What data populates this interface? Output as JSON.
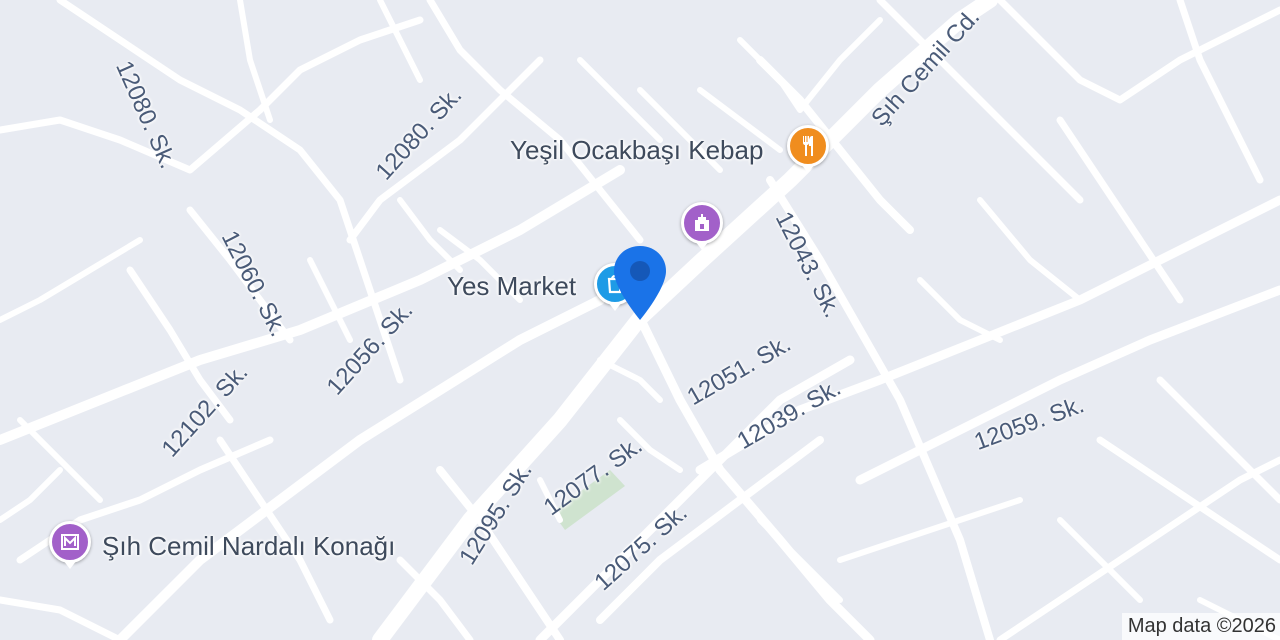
{
  "map": {
    "background_color": "#e8ebf2",
    "road_color": "#ffffff",
    "park_color": "#cfe3cf"
  },
  "street_labels": [
    {
      "text": "12080. Sk."
    },
    {
      "text": "12080. Sk."
    },
    {
      "text": "12060. Sk."
    },
    {
      "text": "12056. Sk."
    },
    {
      "text": "12102. Sk."
    },
    {
      "text": "12043. Sk."
    },
    {
      "text": "12051. Sk."
    },
    {
      "text": "12039. Sk."
    },
    {
      "text": "12059. Sk."
    },
    {
      "text": "12077. Sk."
    },
    {
      "text": "12095. Sk."
    },
    {
      "text": "12075. Sk."
    },
    {
      "text": "Şıh Cemil Cd."
    }
  ],
  "pois": {
    "restaurant": {
      "name": "Yeşil Ocakbaşı Kebap",
      "icon": "fork-knife-icon",
      "color": "#f08d1e"
    },
    "landmark": {
      "name": "",
      "icon": "monument-icon",
      "color": "#a260c9"
    },
    "market": {
      "name": "Yes Market",
      "icon": "shopping-bag-icon",
      "color": "#1e9be6"
    },
    "museum": {
      "name": "Şıh Cemil Nardalı Konağı",
      "icon": "museum-icon",
      "color": "#a260c9"
    }
  },
  "current_location": {
    "icon": "location-pin-icon",
    "color": "#1a73e8"
  },
  "attribution": "Map data ©2026"
}
